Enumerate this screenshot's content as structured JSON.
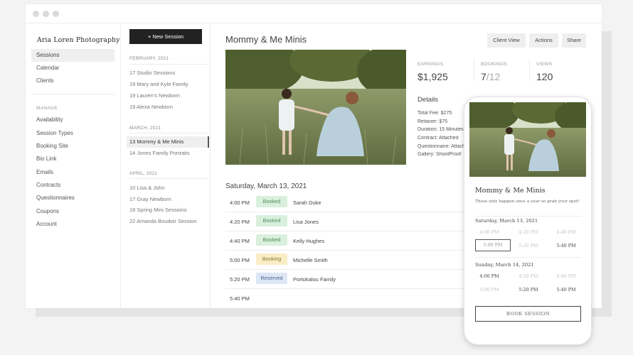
{
  "brand": "Aria Loren Photography",
  "nav": {
    "items": [
      "Sessions",
      "Calendar",
      "Clients"
    ],
    "manage_heading": "MANAGE",
    "manage_items": [
      "Availability",
      "Session Types",
      "Booking Site",
      "Bio Link",
      "Emails",
      "Contracts",
      "Questionnaires",
      "Coupons",
      "Account"
    ]
  },
  "sessions": {
    "new_button": "+ New Session",
    "months": [
      {
        "label": "FEBRUARY, 2021",
        "items": [
          "17 Studio Sessions",
          "19 Mary and Kyle Family",
          "19 Lauren's Newborn",
          "19 Alexa Newborn"
        ]
      },
      {
        "label": "MARCH, 2021",
        "items": [
          "13 Mommy & Me Minis",
          "14 Jones Family Portraits"
        ]
      },
      {
        "label": "APRIL, 2021",
        "items": [
          "10 Lisa & John",
          "17 Gray Newborn",
          "18 Spring Mini Sessions",
          "22 Amanda Boudoir Session"
        ]
      }
    ]
  },
  "main": {
    "title": "Mommy & Me Minis",
    "buttons": {
      "client_view": "Client View",
      "actions": "Actions",
      "share": "Share"
    },
    "stats": {
      "earnings_label": "EARNINGS",
      "earnings_value": "$1,925",
      "bookings_label": "BOOKINGS",
      "bookings_value": "7",
      "bookings_total": "/12",
      "views_label": "VIEWS",
      "views_value": "120"
    },
    "details": {
      "heading": "Details",
      "lines": [
        "Total Fee: $275",
        "Retainer: $75",
        "Duration: 15 Minutes",
        "Contract: Attached",
        "Questionnaire: Attached",
        "Gallery: ShootProof"
      ]
    },
    "day_heading": "Saturday, March 13, 2021",
    "slots": [
      {
        "time": "4:00 PM",
        "status": "Booked",
        "name": "Sarah Duke"
      },
      {
        "time": "4:20 PM",
        "status": "Booked",
        "name": "Lisa Jones"
      },
      {
        "time": "4:40 PM",
        "status": "Booked",
        "name": "Kelly Hughes"
      },
      {
        "time": "5:00 PM",
        "status": "Booking",
        "name": "Michelle Smith"
      },
      {
        "time": "5:20 PM",
        "status": "Reserved",
        "name": "Portokalou Family"
      },
      {
        "time": "5:40 PM",
        "status": "",
        "name": ""
      }
    ]
  },
  "phone": {
    "title": "Mommy & Me Minis",
    "subtitle": "These only happen once a year so grab your spot!",
    "days": [
      {
        "label": "Saturday, March 13, 2021",
        "times": [
          "4:00 PM",
          "4:20 PM",
          "4:40 PM",
          "5:00 PM",
          "5:20 PM",
          "5:40 PM"
        ]
      },
      {
        "label": "Sunday, March 14, 2021",
        "times": [
          "4:00 PM",
          "4:20 PM",
          "4:40 PM",
          "5:00 PM",
          "5:20 PM",
          "5:40 PM"
        ]
      }
    ],
    "book_button": "BOOK SESSION"
  },
  "colors": {
    "booked_bg": "#d9f0dd",
    "booked_fg": "#4d8a5a",
    "booking_bg": "#f8edc4",
    "booking_fg": "#8a7430",
    "reserved_bg": "#dde6f5",
    "reserved_fg": "#4f648e"
  }
}
